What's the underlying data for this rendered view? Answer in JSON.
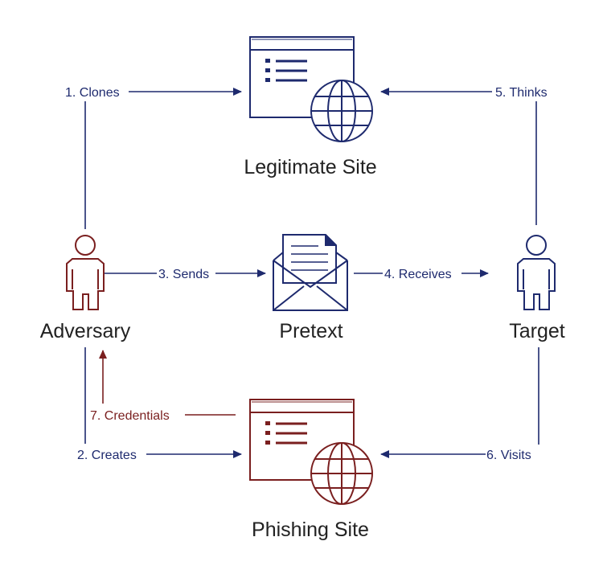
{
  "colors": {
    "blue": "#1e2a6e",
    "red": "#7a1f1f",
    "text": "#222222"
  },
  "nodes": {
    "legitimate_site": "Legitimate Site",
    "adversary": "Adversary",
    "pretext": "Pretext",
    "target": "Target",
    "phishing_site": "Phishing Site"
  },
  "edges": {
    "clones": "1. Clones",
    "creates": "2. Creates",
    "sends": "3. Sends",
    "receives": "4. Receives",
    "thinks": "5. Thinks",
    "visits": "6. Visits",
    "credentials": "7. Credentials"
  },
  "icons": {
    "legitimate_site": "browser-window-globe-icon",
    "phishing_site": "browser-window-globe-icon",
    "adversary": "person-icon",
    "target": "person-icon",
    "pretext": "envelope-letter-icon"
  }
}
